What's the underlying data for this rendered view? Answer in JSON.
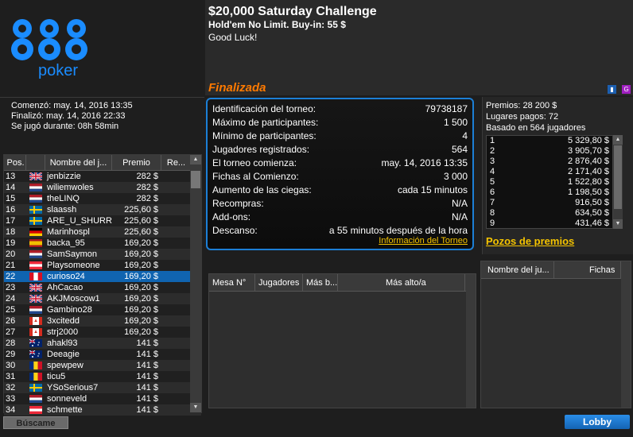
{
  "brand": {
    "name": "888",
    "sub": "poker"
  },
  "tournament": {
    "title": "$20,000 Saturday Challenge",
    "subtitle": "Hold'em No Limit. Buy-in: 55 $",
    "greeting": "Good Luck!",
    "status": "Finalizada"
  },
  "times": {
    "started": "Comenzó: may. 14, 2016 13:35",
    "finished": "Finalizó: may. 14, 2016 22:33",
    "duration": "Se jugó durante: 08h 58min"
  },
  "info": {
    "rows": [
      {
        "label": "Identificación del torneo:",
        "value": "79738187"
      },
      {
        "label": "Máximo de participantes:",
        "value": "1 500"
      },
      {
        "label": "Mínimo de participantes:",
        "value": "4"
      },
      {
        "label": "Jugadores registrados:",
        "value": "564"
      },
      {
        "label": "El torneo comienza:",
        "value": "may. 14, 2016 13:35"
      },
      {
        "label": "Fichas al Comienzo:",
        "value": "3 000"
      },
      {
        "label": "Aumento de las ciegas:",
        "value": "cada 15 minutos"
      },
      {
        "label": "Recompras:",
        "value": "N/A"
      },
      {
        "label": "Add-ons:",
        "value": "N/A"
      },
      {
        "label": "Descanso:",
        "value": "a 55 minutos después de la hora"
      }
    ],
    "link": "Información del Torneo"
  },
  "prizes": {
    "pool": "Premios: 28 200 $",
    "paid_places": "Lugares pagos: 72",
    "based_on": "Basado en 564 jugadores",
    "list": [
      {
        "place": "1",
        "amount": "5 329,80 $"
      },
      {
        "place": "2",
        "amount": "3 905,70 $"
      },
      {
        "place": "3",
        "amount": "2 876,40 $"
      },
      {
        "place": "4",
        "amount": "2 171,40 $"
      },
      {
        "place": "5",
        "amount": "1 522,80 $"
      },
      {
        "place": "6",
        "amount": "1 198,50 $"
      },
      {
        "place": "7",
        "amount": "916,50 $"
      },
      {
        "place": "8",
        "amount": "634,50 $"
      },
      {
        "place": "9",
        "amount": "431,46 $"
      }
    ],
    "pozos_link": "Pozos de premios"
  },
  "players": {
    "headers": {
      "pos": "Pos.",
      "name": "Nombre del j...",
      "prize": "Premio",
      "rest": "Re..."
    },
    "rows": [
      {
        "pos": "13",
        "name": "jenbizzie",
        "prize": "282 $",
        "flag": "gb"
      },
      {
        "pos": "14",
        "name": "wiliemwoles",
        "prize": "282 $",
        "flag": "nl"
      },
      {
        "pos": "15",
        "name": "theLINQ",
        "prize": "282 $",
        "flag": "nl"
      },
      {
        "pos": "16",
        "name": "slaassh",
        "prize": "225,60 $",
        "flag": "se"
      },
      {
        "pos": "17",
        "name": "ARE_U_SHURR",
        "prize": "225,60 $",
        "flag": "se"
      },
      {
        "pos": "18",
        "name": "Marinhospl",
        "prize": "225,60 $",
        "flag": "de"
      },
      {
        "pos": "19",
        "name": "backa_95",
        "prize": "169,20 $",
        "flag": "es"
      },
      {
        "pos": "20",
        "name": "SamSaymon",
        "prize": "169,20 $",
        "flag": "nl"
      },
      {
        "pos": "21",
        "name": "Playsomeone",
        "prize": "169,20 $",
        "flag": "at"
      },
      {
        "pos": "22",
        "name": "curioso24",
        "prize": "169,20 $",
        "flag": "pe"
      },
      {
        "pos": "23",
        "name": "AhCacao",
        "prize": "169,20 $",
        "flag": "gb"
      },
      {
        "pos": "24",
        "name": "AKJMoscow1",
        "prize": "169,20 $",
        "flag": "gb"
      },
      {
        "pos": "25",
        "name": "Gambino28",
        "prize": "169,20 $",
        "flag": "nl"
      },
      {
        "pos": "26",
        "name": "3xcitedd",
        "prize": "169,20 $",
        "flag": "ca"
      },
      {
        "pos": "27",
        "name": "strj2000",
        "prize": "169,20 $",
        "flag": "ca"
      },
      {
        "pos": "28",
        "name": "ahakl93",
        "prize": "141 $",
        "flag": "au"
      },
      {
        "pos": "29",
        "name": "Deeagie",
        "prize": "141 $",
        "flag": "au"
      },
      {
        "pos": "30",
        "name": "spewpew",
        "prize": "141 $",
        "flag": "ro"
      },
      {
        "pos": "31",
        "name": "ticu5",
        "prize": "141 $",
        "flag": "ro"
      },
      {
        "pos": "32",
        "name": "YSoSerious7",
        "prize": "141 $",
        "flag": "se"
      },
      {
        "pos": "33",
        "name": "sonneveld",
        "prize": "141 $",
        "flag": "nl"
      },
      {
        "pos": "34",
        "name": "schmette",
        "prize": "141 $",
        "flag": "at"
      }
    ],
    "selected_pos": "22"
  },
  "tables": {
    "headers": {
      "mesa": "Mesa N°",
      "jugadores": "Jugadores",
      "mas_bajo": "Más b...",
      "mas_alto": "Más alto/a"
    }
  },
  "chips": {
    "headers": {
      "name": "Nombre del ju...",
      "fichas": "Fichas"
    }
  },
  "buttons": {
    "buscame": "Búscame",
    "lobby": "Lobby"
  },
  "colors": {
    "accent_blue": "#1c7fd6",
    "status_orange": "#ff7a00",
    "link_yellow": "#f5c400",
    "selected_row": "#1064b0"
  }
}
